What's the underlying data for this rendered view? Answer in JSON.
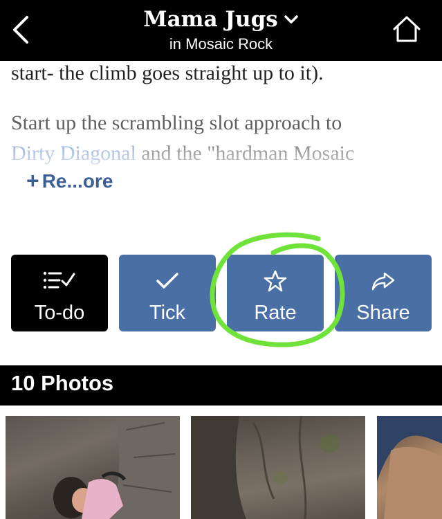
{
  "header": {
    "title": "Mama Jugs",
    "subtitle": "in Mosaic Rock",
    "icons": {
      "back": "chevron-left-icon",
      "dropdown": "chevron-down-icon",
      "home": "home-icon"
    }
  },
  "description": {
    "para1": "start- the climb goes straight up to it).",
    "para2_line1": "Start up the scrambling slot approach to",
    "para2_link": "Dirty Diagonal",
    "para2_rest": " and the \"hardman Mosaic",
    "read_more": "Re...ore"
  },
  "actions": {
    "todo": {
      "label": "To-do",
      "icon": "checklist-icon"
    },
    "tick": {
      "label": "Tick",
      "icon": "check-icon"
    },
    "rate": {
      "label": "Rate",
      "icon": "star-icon"
    },
    "share": {
      "label": "Share",
      "icon": "share-arrow-icon"
    }
  },
  "photos": {
    "heading": "10 Photos",
    "count_visible": 3
  },
  "colors": {
    "header_bg": "#000000",
    "button_blue": "#4a6fa5",
    "todo_bg": "#000000",
    "link": "#7a9bd4",
    "annotation_green": "#6fe33a"
  }
}
